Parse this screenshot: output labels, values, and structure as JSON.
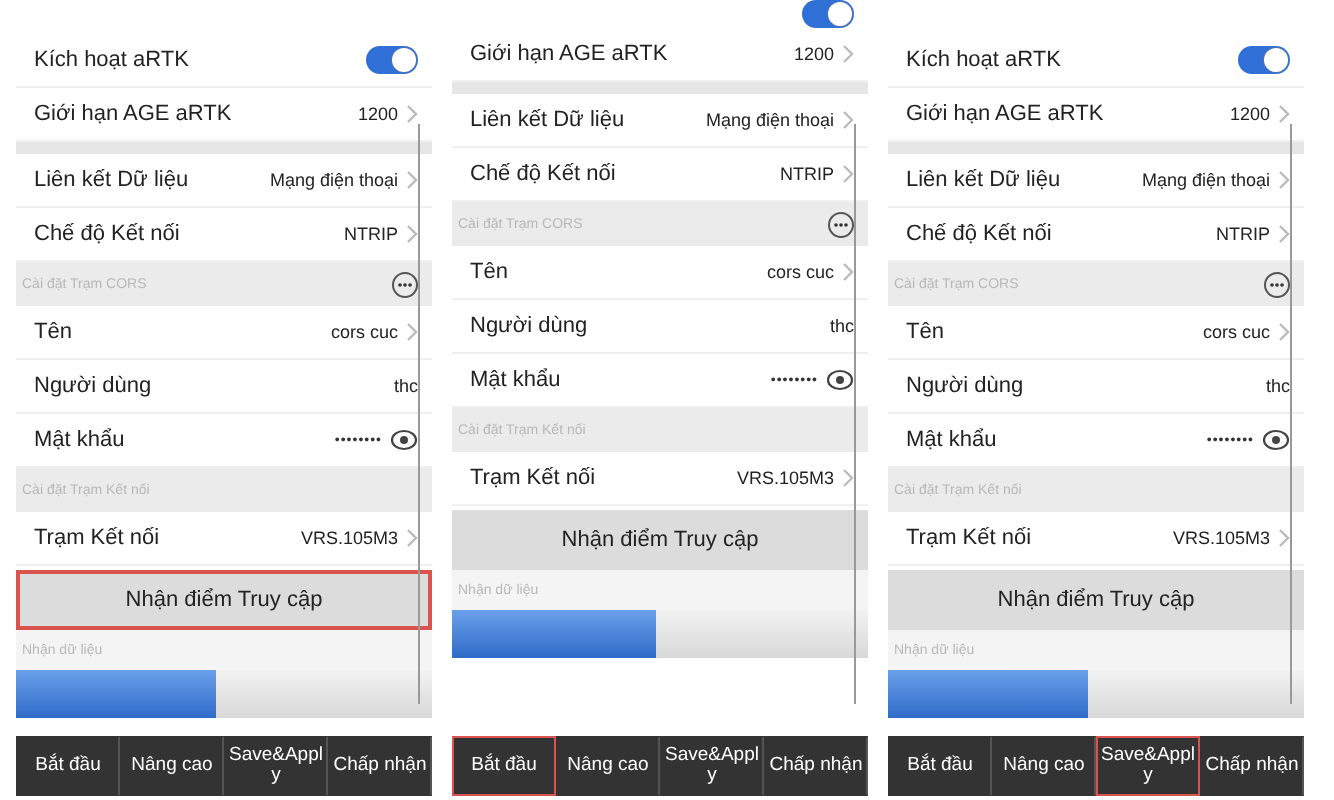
{
  "panels": [
    {
      "rows": [
        {
          "kind": "toggle",
          "label": "Kích hoạt aRTK",
          "on": true
        },
        {
          "kind": "link",
          "label": "Giới hạn AGE aRTK",
          "value": "1200"
        },
        {
          "kind": "spacer"
        },
        {
          "kind": "link",
          "label": "Liên kết Dữ liệu",
          "value": "Mạng điện thoại"
        },
        {
          "kind": "link",
          "label": "Chế độ Kết nối",
          "value": "NTRIP"
        },
        {
          "kind": "section",
          "label": "Cài đặt Trạm CORS",
          "more": true
        },
        {
          "kind": "link",
          "label": "Tên",
          "value": "cors cuc"
        },
        {
          "kind": "text",
          "label": "Người dùng",
          "value": "thc"
        },
        {
          "kind": "password",
          "label": "Mật khẩu",
          "value": "••••••••"
        },
        {
          "kind": "section",
          "label": "Cài đặt Trạm Kết nối",
          "more": false
        },
        {
          "kind": "link",
          "label": "Trạm Kết nối",
          "value": "VRS.105M3"
        }
      ],
      "access_button": {
        "label": "Nhận điểm Truy cập",
        "highlighted": true
      },
      "data_section": "Nhận dữ liệu",
      "progress": {
        "level": 0.48
      },
      "tabs": [
        {
          "label": "Bắt đầu",
          "highlighted": false
        },
        {
          "label": "Nâng cao",
          "highlighted": false
        },
        {
          "label": "Save&Apply",
          "highlighted": false
        },
        {
          "label": "Chấp nhận",
          "highlighted": false
        }
      ]
    },
    {
      "rows": [
        {
          "kind": "toggle-clipped",
          "on": true
        },
        {
          "kind": "link",
          "label": "Giới hạn AGE aRTK",
          "value": "1200"
        },
        {
          "kind": "spacer"
        },
        {
          "kind": "link",
          "label": "Liên kết Dữ liệu",
          "value": "Mạng điện thoại"
        },
        {
          "kind": "link",
          "label": "Chế độ Kết nối",
          "value": "NTRIP"
        },
        {
          "kind": "section",
          "label": "Cài đặt Trạm CORS",
          "more": true
        },
        {
          "kind": "link",
          "label": "Tên",
          "value": "cors cuc"
        },
        {
          "kind": "text",
          "label": "Người dùng",
          "value": "thc"
        },
        {
          "kind": "password",
          "label": "Mật khẩu",
          "value": "••••••••"
        },
        {
          "kind": "section",
          "label": "Cài đặt Trạm Kết nối",
          "more": false
        },
        {
          "kind": "link",
          "label": "Trạm Kết nối",
          "value": "VRS.105M3"
        }
      ],
      "access_button": {
        "label": "Nhận điểm Truy cập",
        "highlighted": false
      },
      "data_section": "Nhận dữ liệu",
      "progress": {
        "level": 0.49
      },
      "tabs": [
        {
          "label": "Bắt đầu",
          "highlighted": true
        },
        {
          "label": "Nâng cao",
          "highlighted": false
        },
        {
          "label": "Save&Apply",
          "highlighted": false
        },
        {
          "label": "Chấp nhận",
          "highlighted": false
        }
      ]
    },
    {
      "rows": [
        {
          "kind": "toggle",
          "label": "Kích hoạt aRTK",
          "on": true
        },
        {
          "kind": "link",
          "label": "Giới hạn AGE aRTK",
          "value": "1200"
        },
        {
          "kind": "spacer"
        },
        {
          "kind": "link",
          "label": "Liên kết Dữ liệu",
          "value": "Mạng điện thoại"
        },
        {
          "kind": "link",
          "label": "Chế độ Kết nối",
          "value": "NTRIP"
        },
        {
          "kind": "section",
          "label": "Cài đặt Trạm CORS",
          "more": true
        },
        {
          "kind": "link",
          "label": "Tên",
          "value": "cors cuc"
        },
        {
          "kind": "text",
          "label": "Người dùng",
          "value": "thc"
        },
        {
          "kind": "password",
          "label": "Mật khẩu",
          "value": "••••••••"
        },
        {
          "kind": "section",
          "label": "Cài đặt Trạm Kết nối",
          "more": false
        },
        {
          "kind": "link",
          "label": "Trạm Kết nối",
          "value": "VRS.105M3"
        }
      ],
      "access_button": {
        "label": "Nhận điểm Truy cập",
        "highlighted": false
      },
      "data_section": "Nhận dữ liệu",
      "progress": {
        "level": 0.48
      },
      "tabs": [
        {
          "label": "Bắt đầu",
          "highlighted": false
        },
        {
          "label": "Nâng cao",
          "highlighted": false
        },
        {
          "label": "Save&Apply",
          "highlighted": true
        },
        {
          "label": "Chấp nhận",
          "highlighted": false
        }
      ]
    }
  ]
}
